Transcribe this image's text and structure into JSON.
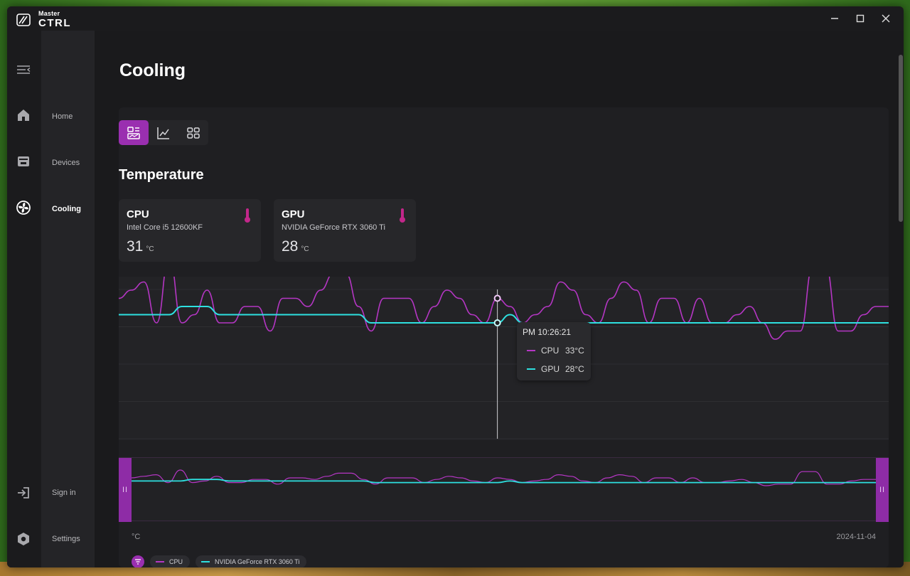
{
  "app": {
    "logo_top": "Master",
    "logo_bottom": "CTRL",
    "minimize_label": "—",
    "maximize_label": "☐",
    "close_label": "✕"
  },
  "nav": {
    "items": [
      {
        "label": "Home",
        "icon": "home-icon"
      },
      {
        "label": "Devices",
        "icon": "devices-icon"
      },
      {
        "label": "Cooling",
        "icon": "fan-icon",
        "active": true
      },
      {
        "label": "Sign in",
        "icon": "sign-in-icon"
      },
      {
        "label": "Settings",
        "icon": "gear-icon"
      }
    ]
  },
  "page": {
    "title": "Cooling",
    "section_title": "Temperature"
  },
  "sensors": [
    {
      "name": "CPU",
      "model": "Intel Core i5 12600KF",
      "value": "31",
      "unit": "°C"
    },
    {
      "name": "GPU",
      "model": "NVIDIA GeForce RTX 3060 Ti",
      "value": "28",
      "unit": "°C"
    }
  ],
  "tooltip": {
    "time": "PM 10:26:21",
    "rows": [
      {
        "name": "CPU",
        "value": "33°C"
      },
      {
        "name": "GPU",
        "value": "28°C"
      }
    ]
  },
  "chart": {
    "unit_label": "°C",
    "date_label": "2024-11-04",
    "handle_glyph": "II",
    "legend": [
      {
        "name": "CPU",
        "color": "#b536c4"
      },
      {
        "name": "NVIDIA GeForce RTX 3060 Ti",
        "color": "#2ee0e0"
      }
    ]
  },
  "colors": {
    "accent": "#9a2fb0",
    "cpu_line": "#b536c4",
    "gpu_line": "#2ee0e0",
    "thermometer": "#c2278a"
  },
  "chart_data": {
    "type": "line",
    "xlabel": "",
    "ylabel": "°C",
    "series": [
      {
        "name": "CPU",
        "values": [
          33,
          34,
          35,
          30,
          38,
          30,
          31,
          34,
          30,
          30,
          32,
          32,
          29,
          33,
          33,
          32,
          34,
          36,
          36,
          32,
          29,
          33,
          33,
          33,
          30,
          32,
          34,
          33,
          31,
          30,
          33,
          32,
          30,
          31,
          32,
          35,
          34,
          31,
          30,
          33,
          35,
          34,
          30,
          33,
          33,
          30,
          33,
          30,
          30,
          31,
          32,
          30,
          28,
          29,
          29,
          37,
          37,
          29,
          29,
          31,
          32,
          32
        ]
      },
      {
        "name": "NVIDIA GeForce RTX 3060 Ti",
        "values": [
          31,
          31,
          31,
          31,
          31,
          32,
          32,
          32,
          31,
          31,
          31,
          31,
          31,
          31,
          31,
          31,
          31,
          31,
          31,
          31,
          30,
          30,
          30,
          30,
          30,
          30,
          30,
          30,
          30,
          30,
          30,
          31,
          30,
          30,
          30,
          30,
          30,
          30,
          30,
          30,
          30,
          30,
          30,
          30,
          30,
          30,
          30,
          30,
          30,
          30,
          30,
          30,
          30,
          30,
          30,
          30,
          30,
          30,
          30,
          30,
          30,
          30
        ]
      }
    ]
  }
}
